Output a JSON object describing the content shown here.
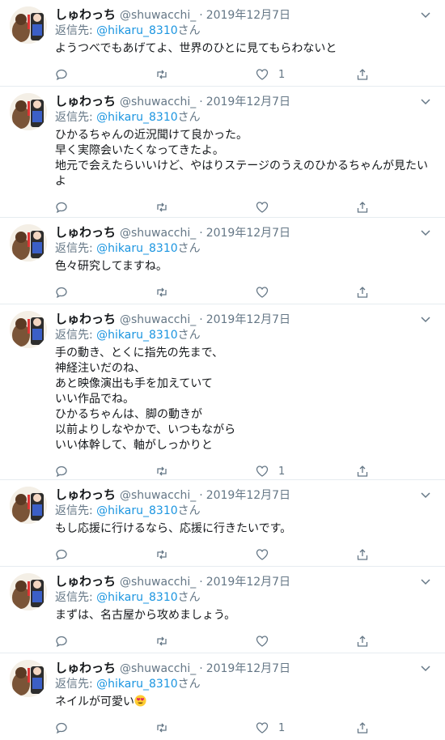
{
  "tweets": [
    {
      "name": "しゅわっち",
      "handle": "@shuwacchi_",
      "sep": "·",
      "date": "2019年12月7日",
      "reply_prefix": "返信先: ",
      "reply_to": "@hikaru_8310",
      "reply_suffix": "さん",
      "text": "ようつべでもあげてよ、世界のひとに見てもらわないと",
      "likes": "1"
    },
    {
      "name": "しゅわっち",
      "handle": "@shuwacchi_",
      "sep": "·",
      "date": "2019年12月7日",
      "reply_prefix": "返信先: ",
      "reply_to": "@hikaru_8310",
      "reply_suffix": "さん",
      "text": "ひかるちゃんの近況聞けて良かった。\n早く実際会いたくなってきたよ。\n地元で会えたらいいけど、やはりステージのうえのひかるちゃんが見たい\nよ",
      "likes": ""
    },
    {
      "name": "しゅわっち",
      "handle": "@shuwacchi_",
      "sep": "·",
      "date": "2019年12月7日",
      "reply_prefix": "返信先: ",
      "reply_to": "@hikaru_8310",
      "reply_suffix": "さん",
      "text": "色々研究してますね。",
      "likes": ""
    },
    {
      "name": "しゅわっち",
      "handle": "@shuwacchi_",
      "sep": "·",
      "date": "2019年12月7日",
      "reply_prefix": "返信先: ",
      "reply_to": "@hikaru_8310",
      "reply_suffix": "さん",
      "text": "手の動き、とくに指先の先まで、\n神経注いだのね、\nあと映像演出も手を加えていて\nいい作品でね。\nひかるちゃんは、脚の動きが\n以前よりしなやかで、いつもながら\nいい体幹して、軸がしっかりと",
      "likes": "1"
    },
    {
      "name": "しゅわっち",
      "handle": "@shuwacchi_",
      "sep": "·",
      "date": "2019年12月7日",
      "reply_prefix": "返信先: ",
      "reply_to": "@hikaru_8310",
      "reply_suffix": "さん",
      "text": "もし応援に行けるなら、応援に行きたいです。",
      "likes": ""
    },
    {
      "name": "しゅわっち",
      "handle": "@shuwacchi_",
      "sep": "·",
      "date": "2019年12月7日",
      "reply_prefix": "返信先: ",
      "reply_to": "@hikaru_8310",
      "reply_suffix": "さん",
      "text": "まずは、名古屋から攻めましょう。",
      "likes": ""
    },
    {
      "name": "しゅわっち",
      "handle": "@shuwacchi_",
      "sep": "·",
      "date": "2019年12月7日",
      "reply_prefix": "返信先: ",
      "reply_to": "@hikaru_8310",
      "reply_suffix": "さん",
      "text": "ネイルが可愛い",
      "emoji": "heart-eyes-emoji",
      "likes": "1"
    }
  ],
  "colors": {
    "link": "#1b95e0",
    "muted": "#657786",
    "divider": "#e6ecf0"
  },
  "icons": [
    "reply-icon",
    "retweet-icon",
    "like-icon",
    "share-icon",
    "caret-down-icon"
  ]
}
